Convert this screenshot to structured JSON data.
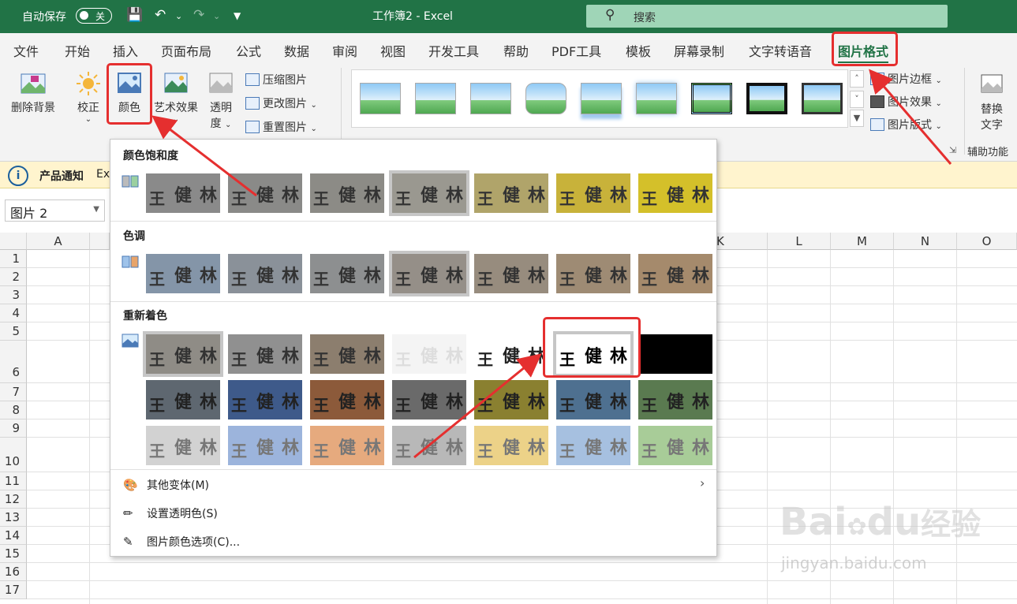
{
  "titlebar": {
    "autosave_label": "自动保存",
    "autosave_state": "关",
    "title": "工作簿2 - Excel",
    "search_placeholder": "搜索"
  },
  "menu": [
    "文件",
    "开始",
    "插入",
    "页面布局",
    "公式",
    "数据",
    "审阅",
    "视图",
    "开发工具",
    "帮助",
    "PDF工具",
    "模板",
    "屏幕录制",
    "文字转语音",
    "图片格式"
  ],
  "ribbon": {
    "remove_bg": "删除背景",
    "correct": "校正",
    "color": "颜色",
    "artistic": "艺术效果",
    "transparency_1": "透明",
    "transparency_2": "度",
    "compress": "压缩图片",
    "change": "更改图片",
    "reset": "重置图片",
    "border": "图片边框",
    "effects": "图片效果",
    "layout": "图片版式",
    "alt_text_1": "替换",
    "alt_text_2": "文字",
    "accessibility": "辅助功能"
  },
  "notify": {
    "title": "产品通知",
    "text": "Ex"
  },
  "namebox": "图片 2",
  "columns": [
    "A",
    "K",
    "L",
    "M",
    "N",
    "O"
  ],
  "rows": [
    "1",
    "2",
    "3",
    "4",
    "5",
    "6",
    "7",
    "8",
    "9",
    "10",
    "11",
    "12",
    "13",
    "14",
    "15",
    "16",
    "17"
  ],
  "popup": {
    "saturation_title": "颜色饱和度",
    "tone_title": "色调",
    "recolor_title": "重新着色",
    "sample_chars": [
      "王",
      "健",
      "林"
    ],
    "more_variants": "其他变体(M)",
    "set_transparent": "设置透明色(S)",
    "color_options": "图片颜色选项(C)..."
  },
  "watermark": {
    "brand": "Bai",
    "brand2": "du",
    "suffix": "经验",
    "url": "jingyan.baidu.com"
  },
  "colors": {
    "accent": "#217346",
    "annotation": "#e52f2f"
  }
}
